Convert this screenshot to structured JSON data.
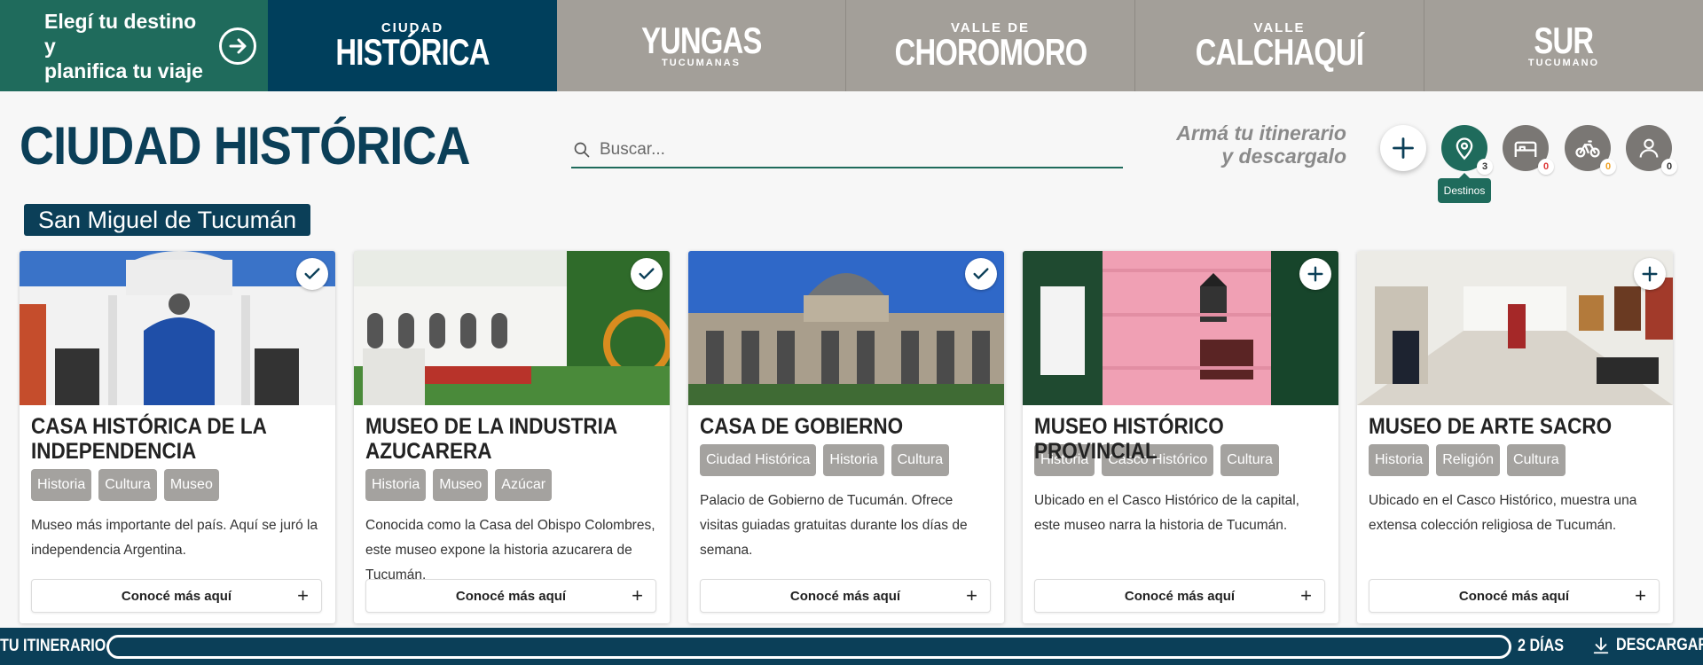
{
  "nav": {
    "cta_line1": "Elegí tu destino y",
    "cta_line2": "planifica tu viaje",
    "regions": [
      {
        "small": "CIUDAD",
        "big": "HISTÓRICA",
        "sub": ""
      },
      {
        "small": "",
        "big": "YUNGAS",
        "sub": "TUCUMANAS"
      },
      {
        "small": "VALLE DE",
        "big": "CHOROMORO",
        "sub": ""
      },
      {
        "small": "VALLE",
        "big": "CALCHAQUÍ",
        "sub": ""
      },
      {
        "small": "",
        "big": "SUR",
        "sub": "TUCUMANO"
      }
    ]
  },
  "header": {
    "title": "CIUDAD HISTÓRICA",
    "search_placeholder": "Buscar...",
    "itinerary_line1": "Armá tu itinerario",
    "itinerary_line2": "y descargalo",
    "tooltip": "Destinos",
    "counts": {
      "destinos": "3",
      "alojamiento": "0",
      "actividades": "0",
      "usuario": "0"
    }
  },
  "city": "San Miguel de Tucumán",
  "cards": [
    {
      "title": "CASA HISTÓRICA DE LA INDEPENDENCIA",
      "tags": [
        "Historia",
        "Cultura",
        "Museo"
      ],
      "desc": "Museo más importante del país. Aquí se juró la independencia Argentina.",
      "more": "Conocé más aquí",
      "added": true
    },
    {
      "title": "MUSEO DE LA INDUSTRIA AZUCARERA",
      "tags": [
        "Historia",
        "Museo",
        "Azúcar"
      ],
      "desc": "Conocida como la Casa del Obispo Colombres, este museo expone la historia azucarera de Tucumán.",
      "more": "Conocé más aquí",
      "added": true
    },
    {
      "title": "CASA DE GOBIERNO",
      "tags": [
        "Ciudad Histórica",
        "Historia",
        "Cultura"
      ],
      "desc": "Palacio de Gobierno de Tucumán. Ofrece visitas guiadas gratuitas durante los días de semana.",
      "more": "Conocé más aquí",
      "added": true
    },
    {
      "title": "MUSEO HISTÓRICO PROVINCIAL",
      "tags": [
        "Historia",
        "Casco Histórico",
        "Cultura"
      ],
      "desc": "Ubicado en el Casco Histórico de la capital, este museo narra la historia de Tucumán.",
      "more": "Conocé más aquí",
      "added": false
    },
    {
      "title": "MUSEO DE ARTE SACRO",
      "tags": [
        "Historia",
        "Religión",
        "Cultura"
      ],
      "desc": "Ubicado en el Casco Histórico, muestra una extensa colección religiosa de Tucumán.",
      "more": "Conocé más aquí",
      "added": false
    }
  ],
  "bottom": {
    "label": "TU ITINERARIO",
    "days": "2 DÍAS",
    "download": "DESCARGAR"
  },
  "colors": {
    "primary_dark": "#0b3f58",
    "primary_green": "#1f6b5c",
    "region_gray": "#a39f99",
    "tag_gray": "#a4a29f"
  }
}
